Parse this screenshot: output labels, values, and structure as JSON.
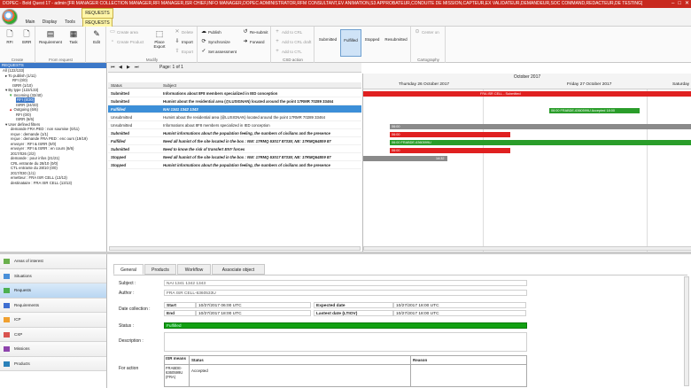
{
  "window": {
    "title": "DOPEC - Bold Quest 17 - admin [FR MANAGER COLLECTION MANAGER,RFI MANAGER,ISR CHIEF,INFO MANAGER,DOPEC ADMINISTRATOR,RFM CONSULTANT,EV ANIMATION,S3 APPROBATEUR,CONDUITE DE MISSION,CAPTEUR,EX VALIDATEUR,DEMANDEUR,SOC COMMAND,REDACTEUR,DE TESTING]",
    "context_tab": "REQUESTS",
    "tabs": [
      "Main",
      "Display",
      "Tools",
      "REQUESTS"
    ]
  },
  "ribbon": {
    "create": {
      "label": "Create",
      "buttons": [
        "RFI",
        "ISRR"
      ]
    },
    "from_request": {
      "label": "From request",
      "buttons": [
        "Requirement",
        "Task"
      ]
    },
    "edit": "Edit",
    "modify": {
      "label": "Modify",
      "create_area": "Create area",
      "create_product": "Create Product",
      "delete": "Delete",
      "import": "Import",
      "export": "Export",
      "place_export": "Place Export"
    },
    "publish": {
      "publish": "Publish",
      "synchronize": "Synchronize",
      "set_assessment": "Set assessment",
      "resubmit": "Re-submit",
      "forward": "Forward"
    },
    "csd": {
      "label": "CSD action",
      "add_crl": "Add to CRL",
      "add_crl_draft": "Add to CRL draft",
      "add_ctl": "Add to CTL"
    },
    "filters": [
      "Submitted",
      "Fulfilled",
      "Stopped",
      "Resubmitted"
    ],
    "cartography": {
      "label": "Cartography",
      "center_on": "Center on"
    }
  },
  "tree": {
    "header": "REQUESTS",
    "items": [
      "All (122/133)",
      "To publish (1/11)",
      "RFI (0/0)",
      "ISRR (1/10)",
      "By type (122/133)",
      "Incoming (32/40)",
      "RFI (8/30)",
      "ISRR (24/33)",
      "Outgoing (6/6)",
      "RFI (0/0)",
      "ISRR (6/6)",
      "User defined filters",
      "demande FRA PED : non soumise (0/11)",
      "reçue : demande (1/1)",
      "reçue : demande FRA PED : enc ours (19/19)",
      "envoyer : RFI & ISRR (0/0)",
      "envoyer : RFI & ISRR : en cours (6/6)",
      "2017/026 (2/2)",
      "demande : pour infos (21/21)",
      "CRL entrante du 28/10 (0/0)",
      "CTL entrante du 28/10 (0/0)",
      "2017/030 (1/1)",
      "emetteur : FRA ISR CELL (13/13)",
      "destinataire : FRA ISR CELL (13/13)"
    ]
  },
  "nav": [
    "Areas of interest",
    "Situations",
    "Requests",
    "Requirements",
    "ICP",
    "CXP",
    "Missions",
    "Products"
  ],
  "grid": {
    "pager": "Page: 1 of 1",
    "columns": [
      "Status",
      "Subject"
    ],
    "rows": [
      {
        "status": "Submitted",
        "subject": "Informations about 8F8 members specialized in IED conception"
      },
      {
        "status": "Submitted",
        "subject": "Humint about the residential area (@LUSIGNAN) located around the point 17RMR 70289 33464"
      },
      {
        "status": "Fulfilled",
        "subject": "NAI 1341 1342 1343"
      },
      {
        "status": "Unsubmitted",
        "subject": "Humint about the residential area (@LUSIGNAN) located around the point 17RMR 70289 33464"
      },
      {
        "status": "Unsubmitted",
        "subject": "Informations about 8F8 members specialized in IED conception"
      },
      {
        "status": "Submitted",
        "subject": "Humint informations about the population feeling, the numbers of civilians and the presence"
      },
      {
        "status": "Fulfilled",
        "subject": "Need all humint of the site located in the box : NW: 17RMQ 53017 87335; NE: 17RMQ54809 87"
      },
      {
        "status": "Submitted",
        "subject": "Need to know the risk of transfert ENY forces"
      },
      {
        "status": "Stopped",
        "subject": "Need all humint of the site located in the box : NW: 17RMQ 53017 87335; NE: 17RMQ54809 87"
      },
      {
        "status": "Stopped",
        "subject": "Humint informations about the population feeling, the numbers of civilians and the presence"
      }
    ]
  },
  "gantt": {
    "month": "October 2017",
    "days": [
      "Thursday 26 October 2017",
      "Friday 27 October 2017",
      "Saturday"
    ],
    "bars": [
      {
        "row": 0,
        "label": "FRA ISR CELL - Submitted",
        "color": "#e02020"
      },
      {
        "row": 2,
        "label": "06:00 FRABDE-6360599U Accepted 18:00",
        "color": "#2a9d2a"
      },
      {
        "row": 4,
        "label": "06:00",
        "color": "#8a8a8a"
      },
      {
        "row": 5,
        "label": "06:00",
        "color": "#e02020"
      },
      {
        "row": 6,
        "label": "06:00 FRABDE-6360599U",
        "color": "#2a9d2a"
      },
      {
        "row": 7,
        "label": "06:00",
        "color": "#e02020"
      },
      {
        "row": 8,
        "label": "14:32",
        "color": "#8a8a8a"
      }
    ]
  },
  "detail": {
    "tabs": [
      "General",
      "Products",
      "Workflow",
      "Associate object"
    ],
    "subject_label": "Subject :",
    "subject": "NAI 1341 1342 1343",
    "author_label": "Author :",
    "author": "FRA ISR CELL-6360533U",
    "collection_label": "Date collection :",
    "start_label": "Start",
    "start": "10/27/2017 06:00 UTC",
    "end_label": "End",
    "end": "10/27/2017 18:00 UTC",
    "expected_label": "Expected date",
    "expected": "10/27/2017 18:00 UTC",
    "latest_label": "Lastest date (LTIOV)",
    "latest": "10/27/2017 18:00 UTC",
    "status_label": "Status :",
    "status": "Fulfilled",
    "description_label": "Description :",
    "action_label": "For action",
    "action_cols": [
      "ISR means",
      "Status",
      "Reason"
    ],
    "action_row": {
      "means": "FRABDE-6360599U (FRA)",
      "status": "Accepted",
      "reason": ""
    }
  },
  "colors": {
    "accent": "#3c78c8",
    "title": "#c8281e",
    "green": "#2a9d2a",
    "red": "#e02020"
  }
}
